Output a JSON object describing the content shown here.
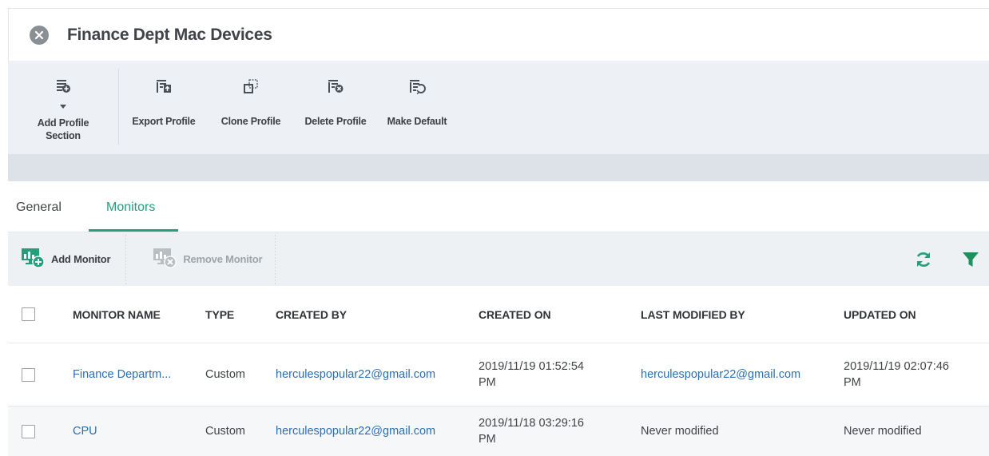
{
  "window": {
    "title": "Finance Dept Mac Devices"
  },
  "toolbar": {
    "add_profile_section": "Add Profile Section",
    "export_profile": "Export Profile",
    "clone_profile": "Clone Profile",
    "delete_profile": "Delete Profile",
    "make_default": "Make Default"
  },
  "tabs": [
    {
      "label": "General",
      "active": false
    },
    {
      "label": "Monitors",
      "active": true
    }
  ],
  "actions": {
    "add_monitor": "Add Monitor",
    "remove_monitor": "Remove Monitor",
    "remove_monitor_enabled": false
  },
  "table": {
    "columns": [
      "MONITOR NAME",
      "TYPE",
      "CREATED BY",
      "CREATED ON",
      "LAST MODIFIED BY",
      "UPDATED ON"
    ],
    "rows": [
      {
        "name": "Finance Departm...",
        "type": "Custom",
        "created_by": "herculespopular22@gmail.com",
        "created_on_date": "2019/11/19 01:52:54",
        "created_on_ampm": "PM",
        "last_modified_by": "herculespopular22@gmail.com",
        "updated_on_date": "2019/11/19 02:07:46",
        "updated_on_ampm": "PM"
      },
      {
        "name": "CPU",
        "type": "Custom",
        "created_by": "herculespopular22@gmail.com",
        "created_on_date": "2019/11/18 03:29:16",
        "created_on_ampm": "PM",
        "last_modified_by": "Never modified",
        "updated_on": "Never modified"
      }
    ]
  },
  "colors": {
    "accent": "#23a07a",
    "link": "#2a6fb5",
    "icon_gray": "#4a5058"
  }
}
